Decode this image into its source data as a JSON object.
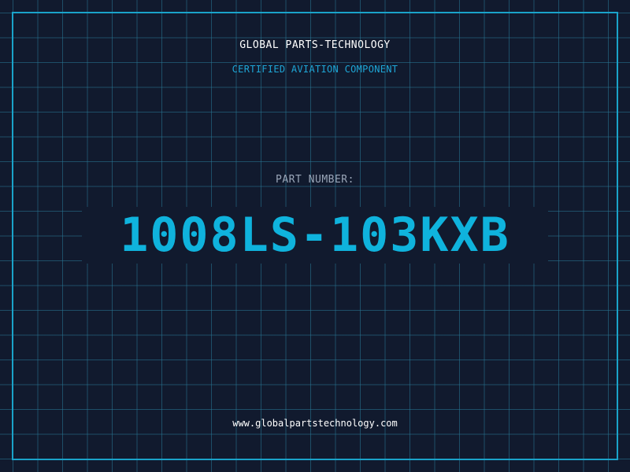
{
  "header": {
    "company": "GLOBAL PARTS-TECHNOLOGY",
    "subtitle": "CERTIFIED AVIATION COMPONENT"
  },
  "part": {
    "label": "PART NUMBER:",
    "number": "1008LS-103KXB"
  },
  "footer": {
    "url": "www.globalpartstechnology.com"
  },
  "colors": {
    "background": "#111a2e",
    "grid": "#287896",
    "accent": "#1aa3c9",
    "part_number": "#0fb3dd",
    "label": "#9aa6b8",
    "text": "#ffffff"
  }
}
